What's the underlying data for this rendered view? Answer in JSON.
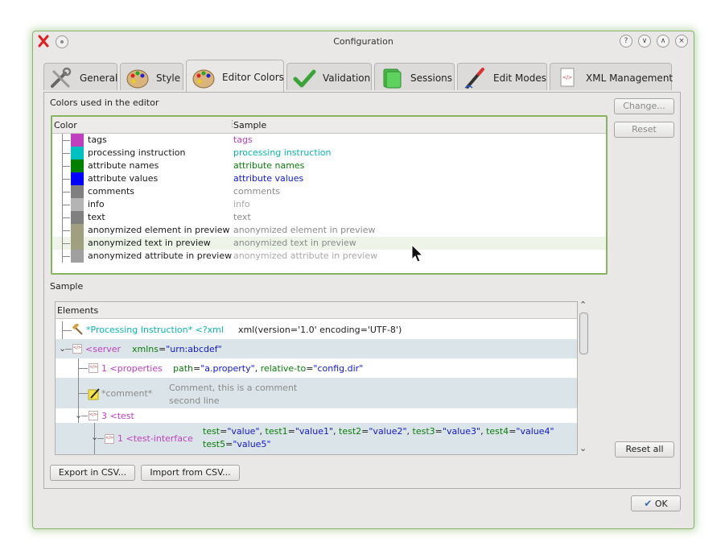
{
  "window": {
    "title": "Configuration"
  },
  "tabs": [
    {
      "label": "General",
      "icon": "tools-icon"
    },
    {
      "label": "Style",
      "icon": "palette-icon"
    },
    {
      "label": "Editor Colors",
      "icon": "palette-icon",
      "active": true
    },
    {
      "label": "Validation",
      "icon": "checkmark-icon"
    },
    {
      "label": "Sessions",
      "icon": "sessions-icon"
    },
    {
      "label": "Edit Modes",
      "icon": "pen-icon"
    },
    {
      "label": "XML Management",
      "icon": "xml-file-icon"
    }
  ],
  "colors_section": {
    "label": "Colors used in the editor",
    "header_color": "Color",
    "header_sample": "Sample",
    "rows": [
      {
        "name": "tags",
        "sample": "tags",
        "swatch": "#bf3fbf"
      },
      {
        "name": "processing instruction",
        "sample": "processing instruction",
        "swatch": "#00c0c0"
      },
      {
        "name": "attribute names",
        "sample": "attribute names",
        "swatch": "#007f00"
      },
      {
        "name": "attribute values",
        "sample": "attribute values",
        "swatch": "#0000ff"
      },
      {
        "name": "comments",
        "sample": "comments",
        "swatch": "#808080"
      },
      {
        "name": "info",
        "sample": "info",
        "swatch": "#b4b4b4"
      },
      {
        "name": "text",
        "sample": "text",
        "swatch": "#808080"
      },
      {
        "name": "anonymized element in preview",
        "sample": "anonymized element in preview",
        "swatch": "#a0a080"
      },
      {
        "name": "anonymized text in preview",
        "sample": "anonymized text in preview",
        "swatch": "#a0a080"
      },
      {
        "name": "anonymized attribute in preview",
        "sample": "anonymized attribute in preview",
        "swatch": "#a0a0a0"
      }
    ]
  },
  "side_buttons": {
    "change": "Change...",
    "reset": "Reset",
    "reset_all": "Reset all"
  },
  "sample_section": {
    "label": "Sample",
    "header": "Elements",
    "pi": {
      "label": "*Processing Instruction* <?xml",
      "value": "xml(version='1.0' encoding='UTF-8')"
    },
    "server": {
      "tag": "<server",
      "attr": "xmlns",
      "eq": "=",
      "val": "\"urn:abcdef\""
    },
    "properties": {
      "tag": "1 <properties",
      "a1": "path",
      "v1": "\"a.property\"",
      "sep": ", ",
      "a2": "relative-to",
      "v2": "\"config.dir\""
    },
    "comment": {
      "label": "*comment*",
      "line1": "Comment, this is a comment",
      "line2": "second line"
    },
    "test": {
      "tag": "3 <test"
    },
    "test_interface": {
      "tag": "1 <test-interface",
      "a1": "test",
      "v1": "\"value\"",
      "a2": "test1",
      "v2": "\"value1\"",
      "a3": "test2",
      "v3": "\"value2\"",
      "a4": "test3",
      "v4": "\"value3\"",
      "a5": "test4",
      "v5": "\"value4\"",
      "a6": "test5",
      "v6": "\"value5\""
    }
  },
  "bottom_buttons": {
    "export": "Export in CSV...",
    "import": "Import from CSV..."
  },
  "ok_button": "OK",
  "colors": {
    "accent_green": "#86b45f",
    "window_bg": "#e9e8e6",
    "row_alt": "#dbe5e9"
  }
}
